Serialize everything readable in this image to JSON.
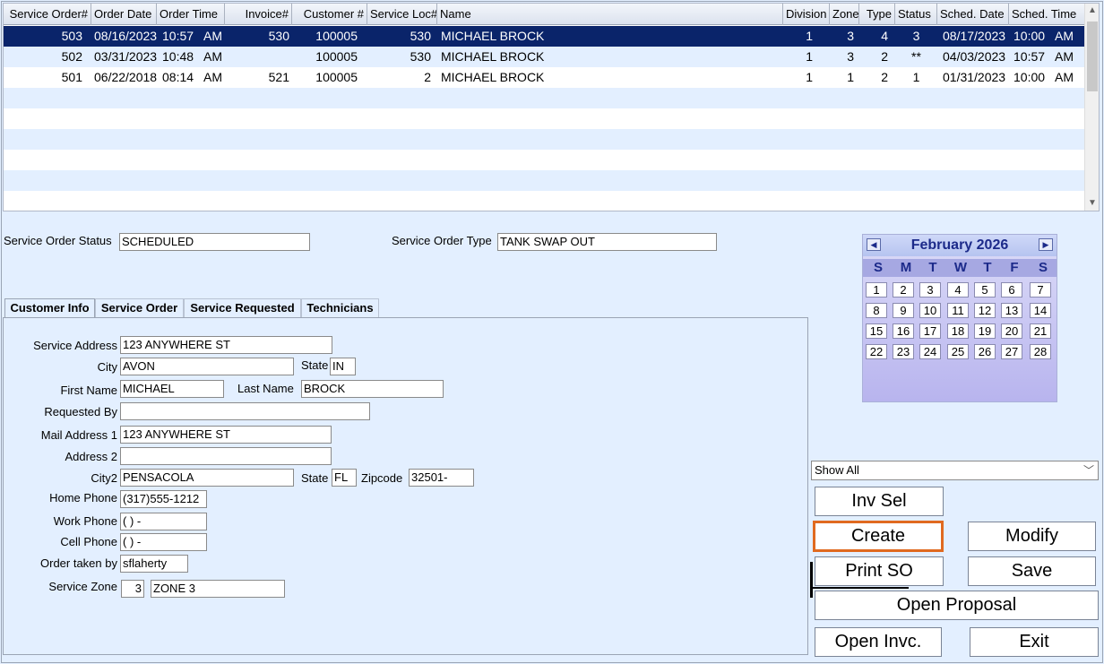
{
  "grid": {
    "columns": [
      "Service Order#",
      "Order Date",
      "Order Time",
      "Invoice#",
      "Customer #",
      "Service Loc#",
      "Name",
      "Division",
      "Zone",
      "Type",
      "Status",
      "Sched. Date",
      "Sched. Time"
    ],
    "rows": [
      {
        "so": "503",
        "date": "08/16/2023",
        "time": "10:57",
        "ampm": "AM",
        "invoice": "530",
        "customer": "100005",
        "loc": "530",
        "name": "MICHAEL BROCK",
        "division": "1",
        "zone": "3",
        "type": "4",
        "status": "3",
        "sdate": "08/17/2023",
        "stime": "10:00",
        "sampm": "AM"
      },
      {
        "so": "502",
        "date": "03/31/2023",
        "time": "10:48",
        "ampm": "AM",
        "invoice": "",
        "customer": "100005",
        "loc": "530",
        "name": "MICHAEL BROCK",
        "division": "1",
        "zone": "3",
        "type": "2",
        "status": "**",
        "sdate": "04/03/2023",
        "stime": "10:57",
        "sampm": "AM"
      },
      {
        "so": "501",
        "date": "06/22/2018",
        "time": "08:14",
        "ampm": "AM",
        "invoice": "521",
        "customer": "100005",
        "loc": "2",
        "name": "MICHAEL BROCK",
        "division": "1",
        "zone": "1",
        "type": "2",
        "status": "1",
        "sdate": "01/31/2023",
        "stime": "10:00",
        "sampm": "AM"
      }
    ]
  },
  "status_section": {
    "status_label": "Service Order Status",
    "status_value": "SCHEDULED",
    "type_label": "Service Order Type",
    "type_value": "TANK SWAP OUT"
  },
  "tabs": [
    "Customer Info",
    "Service Order",
    "Service Requested",
    "Technicians"
  ],
  "customer": {
    "service_address_label": "Service Address",
    "service_address": "123 ANYWHERE ST",
    "city_label": "City",
    "city": "AVON",
    "state_label": "State",
    "state": "IN",
    "first_name_label": "First Name",
    "first_name": "MICHAEL",
    "last_name_label": "Last Name",
    "last_name": "BROCK",
    "requested_by_label": "Requested By",
    "requested_by": "",
    "mail1_label": "Mail Address 1",
    "mail1": "123 ANYWHERE ST",
    "mail2_label": "Address 2",
    "mail2": "",
    "city2_label": "City2",
    "city2": "PENSACOLA",
    "state2_label": "State",
    "state2": "FL",
    "zip_label": "Zipcode",
    "zip": "32501-",
    "home_phone_label": "Home Phone",
    "home_phone": "(317)555-1212",
    "work_phone_label": "Work Phone",
    "work_phone": "(   )   -",
    "cell_phone_label": "Cell Phone",
    "cell_phone": "(   )   -",
    "order_taken_label": "Order taken by",
    "order_taken": "sflaherty",
    "zone_label": "Service Zone",
    "zone_num": "3",
    "zone_name": "ZONE 3"
  },
  "calendar": {
    "title": "February 2026",
    "prev": "◀",
    "next": "▶",
    "dows": [
      "S",
      "M",
      "T",
      "W",
      "T",
      "F",
      "S"
    ],
    "weeks": [
      [
        "1",
        "2",
        "3",
        "4",
        "5",
        "6",
        "7"
      ],
      [
        "8",
        "9",
        "10",
        "11",
        "12",
        "13",
        "14"
      ],
      [
        "15",
        "16",
        "17",
        "18",
        "19",
        "20",
        "21"
      ],
      [
        "22",
        "23",
        "24",
        "25",
        "26",
        "27",
        "28"
      ]
    ]
  },
  "filter": {
    "value": "Show All"
  },
  "buttons": {
    "inv_sel": "Inv Sel",
    "create": "Create",
    "modify": "Modify",
    "print_so": "Print SO",
    "save": "Save",
    "open_proposal": "Open Proposal",
    "open_invc": "Open Invc.",
    "exit": "Exit"
  }
}
